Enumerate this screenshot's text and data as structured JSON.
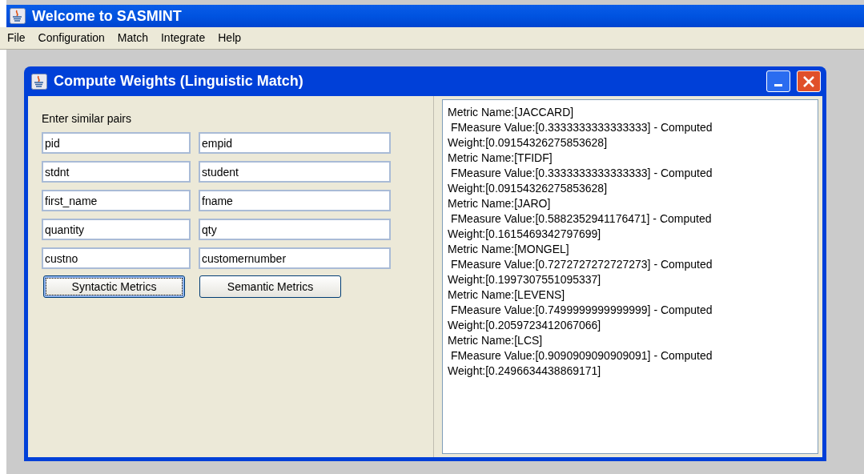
{
  "window": {
    "title": "Welcome to SASMINT"
  },
  "menu": [
    "File",
    "Configuration",
    "Match",
    "Integrate",
    "Help"
  ],
  "dialog": {
    "title": "Compute Weights (Linguistic Match)",
    "prompt": "Enter similar pairs",
    "pairs": [
      [
        "pid",
        "empid"
      ],
      [
        "stdnt",
        "student"
      ],
      [
        "first_name",
        "fname"
      ],
      [
        "quantity",
        "qty"
      ],
      [
        "custno",
        "customernumber"
      ]
    ],
    "buttons": [
      {
        "label": "Syntactic Metrics",
        "focused": true
      },
      {
        "label": "Semantic Metrics",
        "focused": false
      }
    ],
    "output": [
      "Metric Name:[JACCARD]",
      " FMeasure Value:[0.3333333333333333] - Computed",
      "Weight:[0.09154326275853628]",
      "Metric Name:[TFIDF]",
      " FMeasure Value:[0.3333333333333333] - Computed",
      "Weight:[0.09154326275853628]",
      "Metric Name:[JARO]",
      " FMeasure Value:[0.5882352941176471] - Computed",
      "Weight:[0.1615469342797699]",
      "Metric Name:[MONGEL]",
      " FMeasure Value:[0.7272727272727273] - Computed",
      "Weight:[0.1997307551095337]",
      "Metric Name:[LEVENS]",
      " FMeasure Value:[0.7499999999999999] - Computed",
      "Weight:[0.2059723412067066]",
      "Metric Name:[LCS]",
      " FMeasure Value:[0.9090909090909091] - Computed",
      "Weight:[0.2496634438869171]"
    ]
  }
}
